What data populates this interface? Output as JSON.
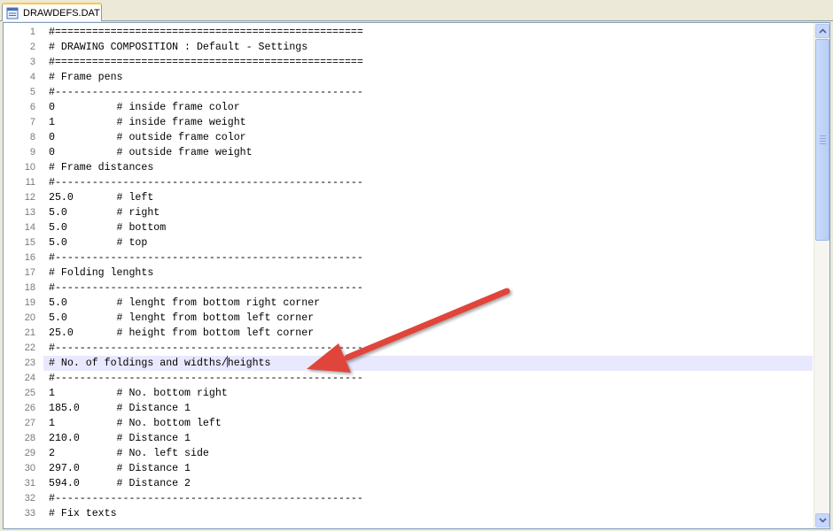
{
  "tab": {
    "file_name": "DRAWDEFS.DAT",
    "icon": "document-icon"
  },
  "editor": {
    "current_line": 23,
    "lines": [
      {
        "num": "1",
        "text": "#=================================================="
      },
      {
        "num": "2",
        "text": "# DRAWING COMPOSITION : Default - Settings"
      },
      {
        "num": "3",
        "text": "#=================================================="
      },
      {
        "num": "4",
        "text": "# Frame pens"
      },
      {
        "num": "5",
        "text": "#--------------------------------------------------"
      },
      {
        "num": "6",
        "text": "0          # inside frame color"
      },
      {
        "num": "7",
        "text": "1          # inside frame weight"
      },
      {
        "num": "8",
        "text": "0          # outside frame color"
      },
      {
        "num": "9",
        "text": "0          # outside frame weight"
      },
      {
        "num": "10",
        "text": "# Frame distances"
      },
      {
        "num": "11",
        "text": "#--------------------------------------------------"
      },
      {
        "num": "12",
        "text": "25.0       # left"
      },
      {
        "num": "13",
        "text": "5.0        # right"
      },
      {
        "num": "14",
        "text": "5.0        # bottom"
      },
      {
        "num": "15",
        "text": "5.0        # top"
      },
      {
        "num": "16",
        "text": "#--------------------------------------------------"
      },
      {
        "num": "17",
        "text": "# Folding lenghts"
      },
      {
        "num": "18",
        "text": "#--------------------------------------------------"
      },
      {
        "num": "19",
        "text": "5.0        # lenght from bottom right corner"
      },
      {
        "num": "20",
        "text": "5.0        # lenght from bottom left corner"
      },
      {
        "num": "21",
        "text": "25.0       # height from bottom left corner"
      },
      {
        "num": "22",
        "text": "#--------------------------------------------------"
      },
      {
        "num": "23",
        "text": "# No. of foldings and widths/heights",
        "caret_before": "# No. of foldings and widths/",
        "caret_after": "heights"
      },
      {
        "num": "24",
        "text": "#--------------------------------------------------"
      },
      {
        "num": "25",
        "text": "1          # No. bottom right"
      },
      {
        "num": "26",
        "text": "185.0      # Distance 1"
      },
      {
        "num": "27",
        "text": "1          # No. bottom left"
      },
      {
        "num": "28",
        "text": "210.0      # Distance 1"
      },
      {
        "num": "29",
        "text": "2          # No. left side"
      },
      {
        "num": "30",
        "text": "297.0      # Distance 1"
      },
      {
        "num": "31",
        "text": "594.0      # Distance 2"
      },
      {
        "num": "32",
        "text": "#--------------------------------------------------"
      },
      {
        "num": "33",
        "text": "# Fix texts"
      }
    ]
  },
  "colors": {
    "highlight_line": "#e8e8ff",
    "annotation_arrow": "#e0453a",
    "line_number": "#7a7a7a"
  }
}
